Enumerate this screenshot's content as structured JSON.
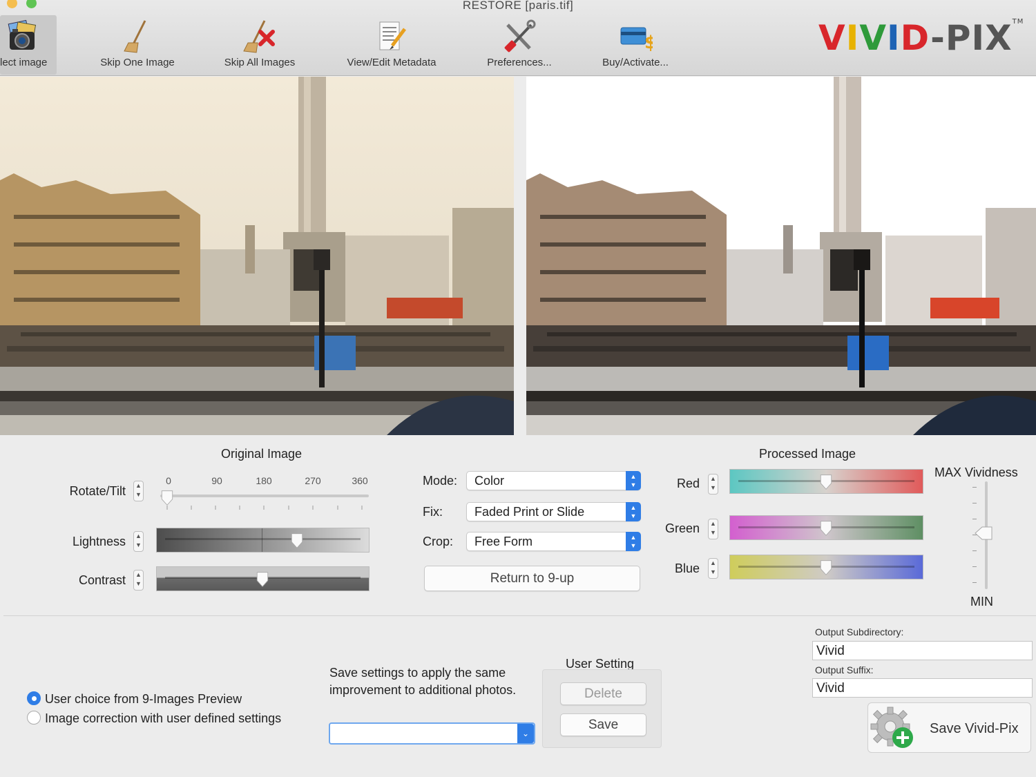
{
  "window": {
    "title": "RESTORE [paris.tif]",
    "traffic_colors": [
      "#f5be4f",
      "#5fc454"
    ]
  },
  "toolbar": {
    "items": [
      {
        "label": "lect image",
        "icon": "camera-photos-icon",
        "active": true
      },
      {
        "label": "Skip One Image",
        "icon": "broom-icon"
      },
      {
        "label": "Skip All Images",
        "icon": "broom-x-icon"
      },
      {
        "label": "View/Edit Metadata",
        "icon": "document-pencil-icon"
      },
      {
        "label": "Preferences...",
        "icon": "tools-icon"
      },
      {
        "label": "Buy/Activate...",
        "icon": "credit-card-dollar-icon"
      }
    ]
  },
  "logo": {
    "letters": [
      {
        "ch": "V",
        "color": "#d8262b"
      },
      {
        "ch": "I",
        "color": "#e7b200"
      },
      {
        "ch": "V",
        "color": "#2e9a3a"
      },
      {
        "ch": "I",
        "color": "#1e63b4"
      },
      {
        "ch": "D",
        "color": "#d8262b"
      },
      {
        "ch": "-",
        "color": "#555555"
      },
      {
        "ch": "P",
        "color": "#555555"
      },
      {
        "ch": "I",
        "color": "#555555"
      },
      {
        "ch": "X",
        "color": "#555555"
      }
    ],
    "tm": "TM"
  },
  "original": {
    "title": "Original Image",
    "rotate": {
      "label": "Rotate/Tilt",
      "ticks": [
        "0",
        "90",
        "180",
        "270",
        "360"
      ],
      "value": 0
    },
    "lightness": {
      "label": "Lightness",
      "value": 0.68
    },
    "contrast": {
      "label": "Contrast",
      "value": 0.5
    }
  },
  "mode": {
    "mode_label": "Mode:",
    "mode_value": "Color",
    "fix_label": "Fix:",
    "fix_value": "Faded Print or Slide",
    "crop_label": "Crop:",
    "crop_value": "Free Form",
    "return_button": "Return to 9-up"
  },
  "processed": {
    "title": "Processed Image",
    "red": {
      "label": "Red",
      "value": 0.5
    },
    "green": {
      "label": "Green",
      "value": 0.5
    },
    "blue": {
      "label": "Blue",
      "value": 0.5
    },
    "vividness": {
      "max_label": "MAX Vividness",
      "min_label": "MIN",
      "value": 0.5
    }
  },
  "options": {
    "radio_1": "User choice from 9-Images Preview",
    "radio_2": "Image correction with user defined settings",
    "selected": 1
  },
  "save_settings": {
    "text_line1": "Save settings to apply the same",
    "text_line2": "improvement to additional photos.",
    "combo_value": ""
  },
  "user_setting": {
    "title": "User Setting",
    "delete_button": "Delete",
    "save_button": "Save"
  },
  "output": {
    "subdir_label": "Output Subdirectory:",
    "subdir_value": "Vivid",
    "suffix_label": "Output Suffix:",
    "suffix_value": "Vivid",
    "save_button": "Save Vivid-Pix"
  }
}
